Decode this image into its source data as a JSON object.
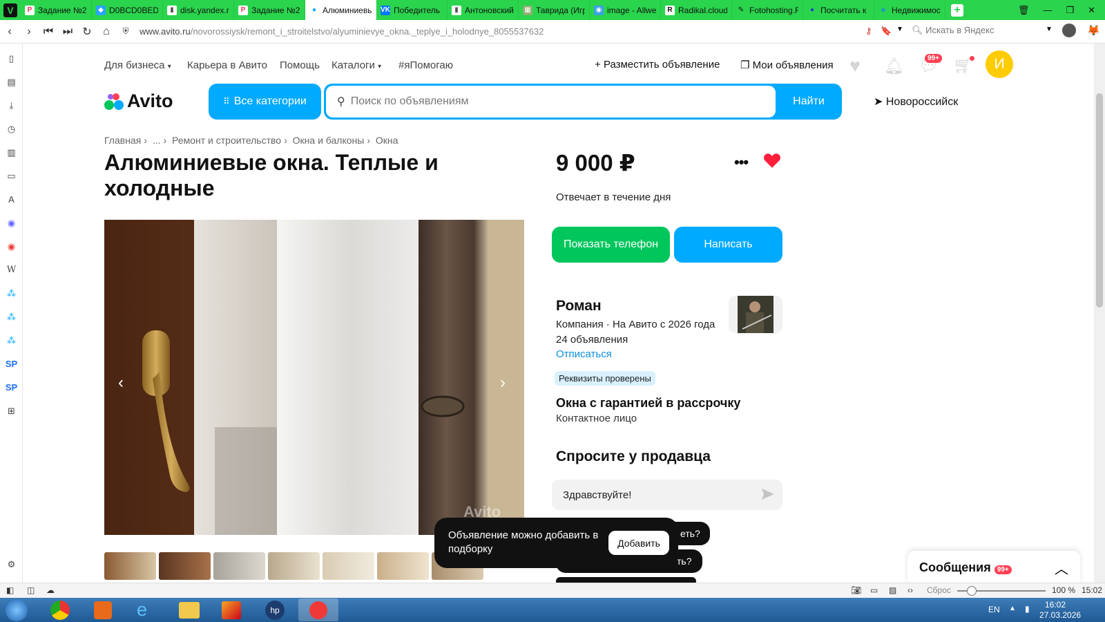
{
  "browser": {
    "tabs": [
      {
        "label": "Задание №2",
        "icon": "P",
        "color": "#ffffff",
        "fg": "#e35"
      },
      {
        "label": "D0BCD0BED0",
        "icon": "◆",
        "color": "#29a3ff",
        "fg": "#fff"
      },
      {
        "label": "disk.yandex.r",
        "icon": "▮",
        "color": "#ffffff",
        "fg": "#555"
      },
      {
        "label": "Задание №2",
        "icon": "P",
        "color": "#ffffff",
        "fg": "#e35"
      },
      {
        "label": "Алюминиевы",
        "icon": "●",
        "color": "#ffffff",
        "fg": "#0af"
      },
      {
        "label": "Победитель",
        "icon": "VK",
        "color": "#0077ff",
        "fg": "#fff"
      },
      {
        "label": "Антоновский",
        "icon": "▮",
        "color": "#ffffff",
        "fg": "#555"
      },
      {
        "label": "Таврида (Игр",
        "icon": "▦",
        "color": "#8bb070",
        "fg": "#fff"
      },
      {
        "label": "image - Allwe",
        "icon": "◉",
        "color": "#3aa0e8",
        "fg": "#fff"
      },
      {
        "label": "Radikal.cloud",
        "icon": "R",
        "color": "#ffffff",
        "fg": "#111"
      },
      {
        "label": "Fotohosting.F",
        "icon": "✎",
        "color": "#2bd44d",
        "fg": "#111"
      },
      {
        "label": "Посчитать к",
        "icon": "●",
        "color": "#2bd44d",
        "fg": "#1a3cd6"
      },
      {
        "label": "Недвижимос",
        "icon": "◈",
        "color": "#2bd44d",
        "fg": "#1b8fd6"
      }
    ],
    "active_tab": 4,
    "url_host": "www.avito.ru",
    "url_path": "/novorossiysk/remont_i_stroitelstvo/alyuminievye_okna._teplye_i_holodnye_8055537632",
    "search_placeholder": "Искать в Яндекс",
    "zoom": "100 %",
    "reset_label": "Сброс",
    "status_time": "15:02",
    "lang": "EN",
    "clock_time": "16:02",
    "clock_date": "27.03.2026"
  },
  "header": {
    "links": [
      "Для бизнеса",
      "Карьера в Авито",
      "Помощь",
      "Каталоги",
      "#яПомогаю"
    ],
    "post_ad": "Разместить объявление",
    "my_ads": "Мои объявления",
    "messages_badge": "99+",
    "avatar_letter": "И",
    "logo_text": "Avito",
    "categories_btn": "Все категории",
    "search_placeholder": "Поиск по объявлениям",
    "search_btn": "Найти",
    "city": "Новороссийск"
  },
  "breadcrumb": [
    "Главная",
    "...",
    "Ремонт и строительство",
    "Окна и балконы",
    "Окна"
  ],
  "listing": {
    "title": "Алюминиевые окна. Теплые и холодные",
    "price": "9 000 ₽",
    "responds": "Отвечает в течение дня",
    "show_phone": "Показать телефон",
    "write": "Написать",
    "seller_name": "Роман",
    "seller_type": "Компания · На Авито с 2026 года",
    "ads_count": "24 объявления",
    "unsubscribe": "Отписаться",
    "verified": "Реквизиты проверены",
    "company": "Окна с гарантией в рассрочку",
    "contact": "Контактное лицо",
    "ask_title": "Спросите у продавца",
    "ask_value": "Здравствуйте!",
    "pill1": "еть?",
    "pill2": "ть?",
    "watermark": "Avito"
  },
  "toast": {
    "text": "Объявление можно добавить в подборку",
    "button": "Добавить"
  },
  "messages": {
    "label": "Сообщения",
    "badge": "99+"
  }
}
